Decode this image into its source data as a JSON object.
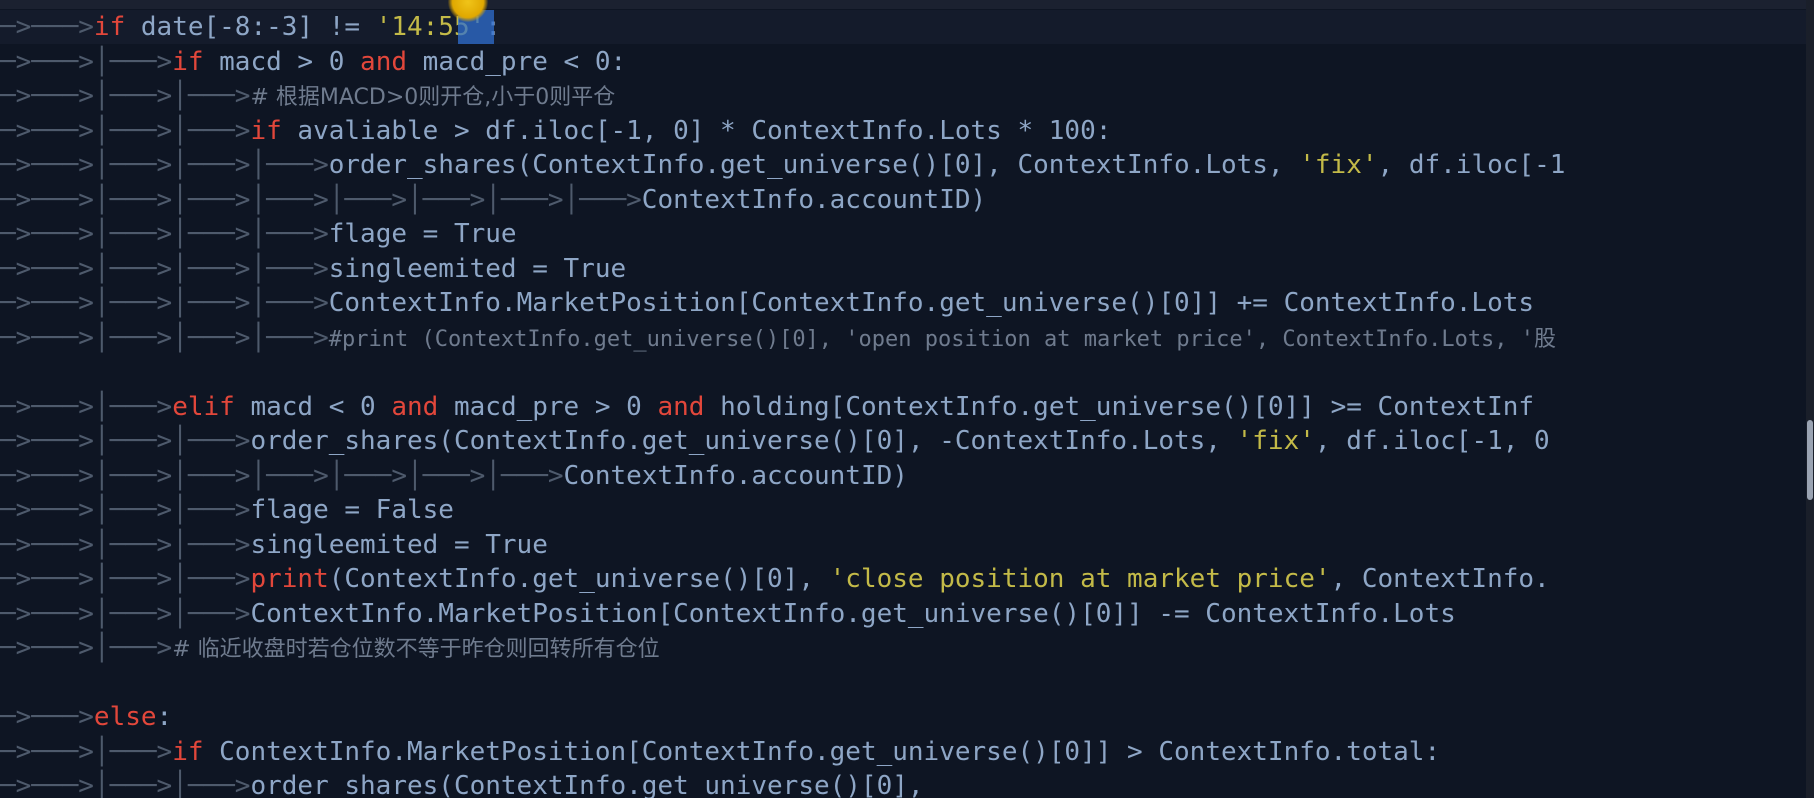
{
  "editor": {
    "language": "python",
    "colors": {
      "background": "#0e1523",
      "keyword": "#e2473b",
      "text": "#8ea6c6",
      "string": "#c3ba48",
      "comment": "#6f7b8e",
      "guide": "#4e5a6c"
    },
    "lines": [
      {
        "guides": "─>───>",
        "segments": [
          {
            "t": "kw",
            "v": "if"
          },
          {
            "t": "tx",
            "v": " date[-8:-3] != "
          },
          {
            "t": "str",
            "v": "'14:55'"
          },
          {
            "t": "tx",
            "v": ":"
          }
        ]
      },
      {
        "guides": "─>───>│───>",
        "segments": [
          {
            "t": "kw",
            "v": "if"
          },
          {
            "t": "tx",
            "v": " macd > 0 "
          },
          {
            "t": "kw",
            "v": "and"
          },
          {
            "t": "tx",
            "v": " macd_pre < 0:"
          }
        ]
      },
      {
        "guides": "─>───>│───>│───>",
        "segments": [
          {
            "t": "cmt-cjk",
            "v": "# 根据MACD>0则开仓,小于0则平仓"
          }
        ]
      },
      {
        "guides": "─>───>│───>│───>",
        "segments": [
          {
            "t": "kw",
            "v": "if"
          },
          {
            "t": "tx",
            "v": " avaliable > df.iloc[-1, 0] * ContextInfo.Lots * 100:"
          }
        ]
      },
      {
        "guides": "─>───>│───>│───>│───>",
        "segments": [
          {
            "t": "tx",
            "v": "order_shares(ContextInfo.get_universe()[0], ContextInfo.Lots, "
          },
          {
            "t": "str",
            "v": "'fix'"
          },
          {
            "t": "tx",
            "v": ", df.iloc[-1"
          }
        ]
      },
      {
        "guides": "─>───>│───>│───>│───>│───>│───>│───>│───>",
        "segments": [
          {
            "t": "tx",
            "v": "ContextInfo.accountID)"
          }
        ]
      },
      {
        "guides": "─>───>│───>│───>│───>",
        "segments": [
          {
            "t": "tx",
            "v": "flage = True"
          }
        ]
      },
      {
        "guides": "─>───>│───>│───>│───>",
        "segments": [
          {
            "t": "tx",
            "v": "singleemited = True"
          }
        ]
      },
      {
        "guides": "─>───>│───>│───>│───>",
        "segments": [
          {
            "t": "tx",
            "v": "ContextInfo.MarketPosition[ContextInfo.get_universe()[0]] += ContextInfo.Lots"
          }
        ]
      },
      {
        "guides": "─>───>│───>│───>│───>",
        "segments": [
          {
            "t": "cmt-small",
            "v": "#print (ContextInfo.get_universe()[0], 'open position at market price', ContextInfo.Lots, '股"
          }
        ]
      },
      {
        "guides": "",
        "segments": []
      },
      {
        "guides": "─>───>│───>",
        "segments": [
          {
            "t": "kw",
            "v": "elif"
          },
          {
            "t": "tx",
            "v": " macd < 0 "
          },
          {
            "t": "kw",
            "v": "and"
          },
          {
            "t": "tx",
            "v": " macd_pre > 0 "
          },
          {
            "t": "kw",
            "v": "and"
          },
          {
            "t": "tx",
            "v": " holding[ContextInfo.get_universe()[0]] >= ContextInf"
          }
        ]
      },
      {
        "guides": "─>───>│───>│───>",
        "segments": [
          {
            "t": "tx",
            "v": "order_shares(ContextInfo.get_universe()[0], -ContextInfo.Lots, "
          },
          {
            "t": "str",
            "v": "'fix'"
          },
          {
            "t": "tx",
            "v": ", df.iloc[-1, 0"
          }
        ]
      },
      {
        "guides": "─>───>│───>│───>│───>│───>│───>│───>",
        "segments": [
          {
            "t": "tx",
            "v": "ContextInfo.accountID)"
          }
        ]
      },
      {
        "guides": "─>───>│───>│───>",
        "segments": [
          {
            "t": "tx",
            "v": "flage = False"
          }
        ]
      },
      {
        "guides": "─>───>│───>│───>",
        "segments": [
          {
            "t": "tx",
            "v": "singleemited = True"
          }
        ]
      },
      {
        "guides": "─>───>│───>│───>",
        "segments": [
          {
            "t": "kw",
            "v": "print"
          },
          {
            "t": "tx",
            "v": "(ContextInfo.get_universe()[0], "
          },
          {
            "t": "str",
            "v": "'close position at market price'"
          },
          {
            "t": "tx",
            "v": ", ContextInfo."
          }
        ]
      },
      {
        "guides": "─>───>│───>│───>",
        "segments": [
          {
            "t": "tx",
            "v": "ContextInfo.MarketPosition[ContextInfo.get_universe()[0]] -= ContextInfo.Lots"
          }
        ]
      },
      {
        "guides": "─>───>│───>",
        "segments": [
          {
            "t": "cmt-cjk",
            "v": "# 临近收盘时若仓位数不等于昨仓则回转所有仓位"
          }
        ]
      },
      {
        "guides": "",
        "segments": []
      },
      {
        "guides": "─>───>",
        "segments": [
          {
            "t": "kw",
            "v": "else"
          },
          {
            "t": "tx",
            "v": ":"
          }
        ]
      },
      {
        "guides": "─>───>│───>",
        "segments": [
          {
            "t": "kw",
            "v": "if"
          },
          {
            "t": "tx",
            "v": " ContextInfo.MarketPosition[ContextInfo.get_universe()[0]] > ContextInfo.total:"
          }
        ]
      },
      {
        "guides": "─>───>│───>│───>",
        "segments": [
          {
            "t": "tx",
            "v": "order_shares(ContextInfo.get_universe()[0],"
          }
        ]
      }
    ]
  }
}
